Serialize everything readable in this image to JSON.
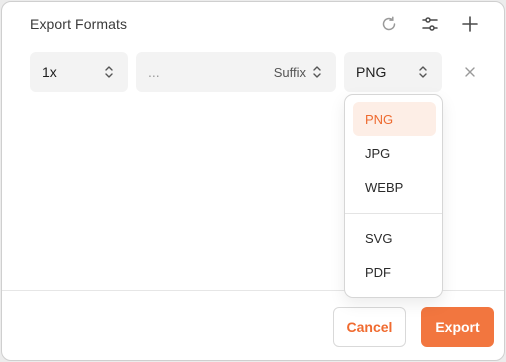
{
  "dialog": {
    "title": "Export Formats",
    "header_icons": [
      "reset-icon",
      "settings-sliders-icon",
      "plus-icon"
    ]
  },
  "row": {
    "scale": {
      "value": "1x"
    },
    "suffix": {
      "placeholder": "...",
      "label": "Suffix"
    },
    "format": {
      "value": "PNG"
    },
    "remove_icon": "close-icon"
  },
  "dropdown": {
    "group1": [
      "PNG",
      "JPG",
      "WEBP"
    ],
    "group2": [
      "SVG",
      "PDF"
    ],
    "selected": "PNG"
  },
  "footer": {
    "cancel_label": "Cancel",
    "export_label": "Export"
  },
  "colors": {
    "accent": "#f2763f",
    "accent_text": "#ee6a2f",
    "selected_bg": "#fdeee6"
  }
}
